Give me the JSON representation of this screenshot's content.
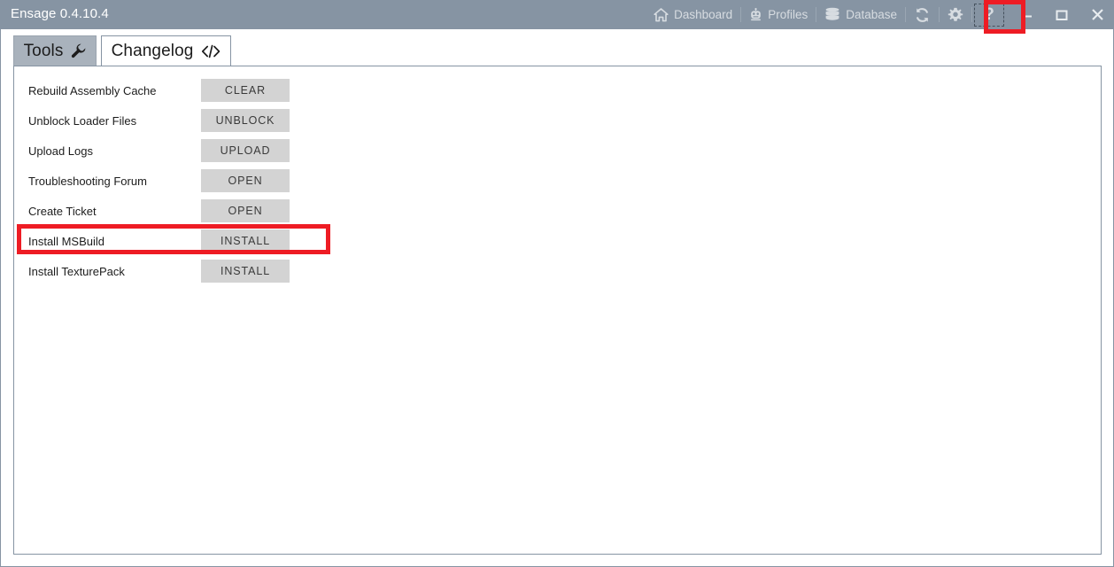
{
  "window": {
    "title": "Ensage 0.4.10.4"
  },
  "toolbar": {
    "items": [
      {
        "label": "Dashboard",
        "icon": "home-icon"
      },
      {
        "label": "Profiles",
        "icon": "robot-icon"
      },
      {
        "label": "Database",
        "icon": "database-icon"
      },
      {
        "label": "",
        "icon": "refresh-icon"
      },
      {
        "label": "",
        "icon": "gear-icon"
      }
    ],
    "help_label": "?"
  },
  "window_controls": {
    "minimize": "minimize-icon",
    "maximize": "maximize-icon",
    "close": "close-icon"
  },
  "tabs": [
    {
      "label": "Tools",
      "icon": "wrench-icon",
      "selected": true
    },
    {
      "label": "Changelog",
      "icon": "code-icon",
      "selected": false
    }
  ],
  "tools": {
    "rows": [
      {
        "label": "Rebuild Assembly Cache",
        "action": "CLEAR"
      },
      {
        "label": "Unblock Loader Files",
        "action": "UNBLOCK"
      },
      {
        "label": "Upload Logs",
        "action": "UPLOAD"
      },
      {
        "label": "Troubleshooting Forum",
        "action": "OPEN"
      },
      {
        "label": "Create Ticket",
        "action": "OPEN"
      },
      {
        "label": "Install MSBuild",
        "action": "INSTALL"
      },
      {
        "label": "Install TexturePack",
        "action": "INSTALL"
      }
    ]
  },
  "annotations": {
    "highlight_color": "#ee1c24",
    "highlighted_row": "Install MSBuild",
    "highlighted_button": "?"
  },
  "colors": {
    "title_bar": "#8694a3",
    "tab_selected": "#a9b2bc",
    "button_face": "#d3d3d3",
    "panel_border": "#8694a3"
  }
}
